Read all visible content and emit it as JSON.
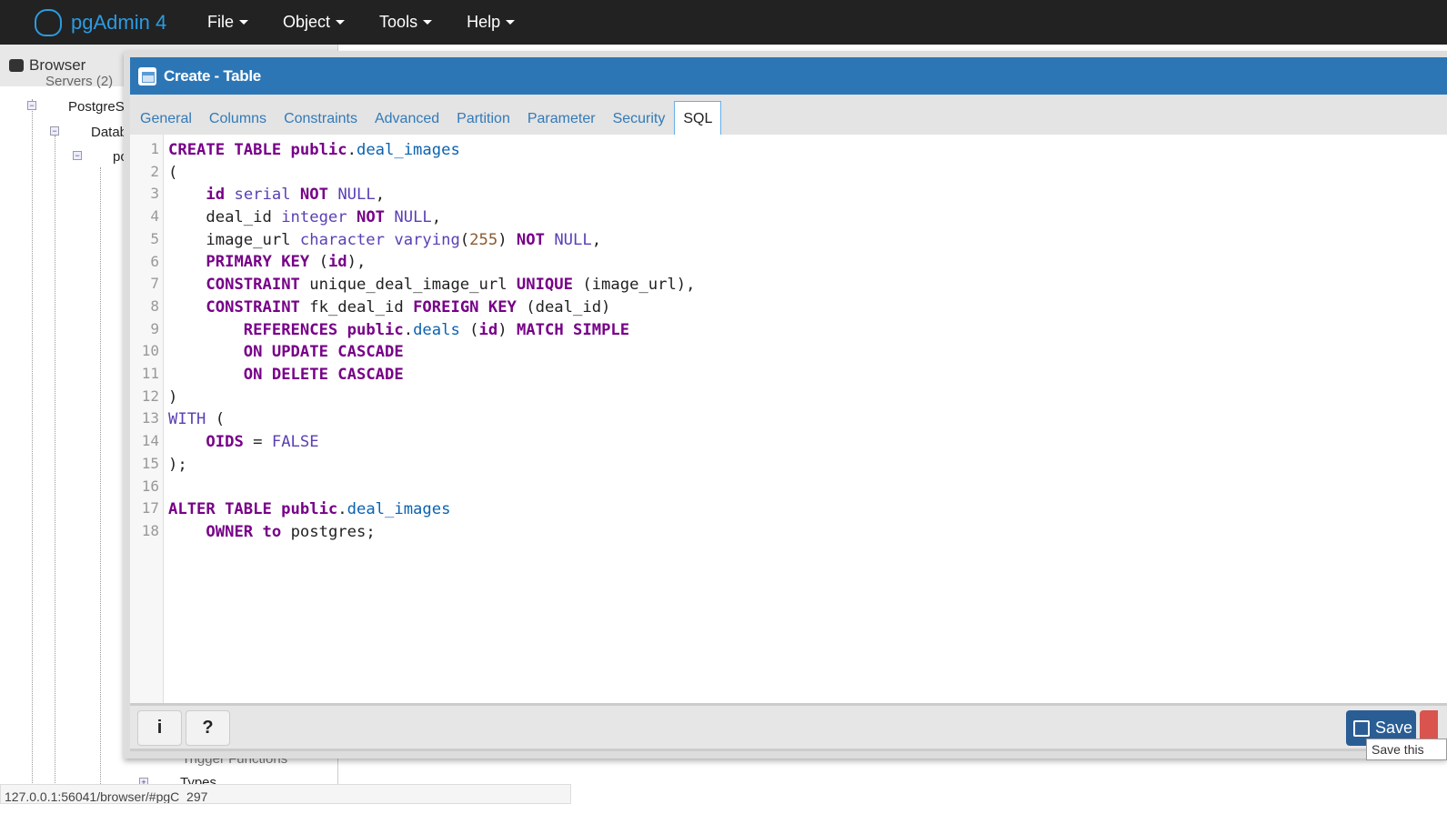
{
  "app": {
    "title": "pgAdmin 4",
    "menus": [
      "File",
      "Object",
      "Tools",
      "Help"
    ]
  },
  "browser": {
    "title": "Browser",
    "tree": [
      "Servers (2)",
      "PostgreSQL",
      "Databases",
      "postgres",
      "Trigger Functions",
      "Types"
    ]
  },
  "dialog": {
    "title": "Create - Table",
    "tabs": [
      {
        "label": "General"
      },
      {
        "label": "Columns"
      },
      {
        "label": "Constraints"
      },
      {
        "label": "Advanced"
      },
      {
        "label": "Partition"
      },
      {
        "label": "Parameter"
      },
      {
        "label": "Security"
      },
      {
        "label": "SQL",
        "active": true
      }
    ],
    "sql_lines": [
      [
        [
          "kw",
          "CREATE TABLE public"
        ],
        [
          "pl",
          "."
        ],
        [
          "tb",
          "deal_images"
        ]
      ],
      [
        [
          "pl",
          "("
        ]
      ],
      [
        [
          "pl",
          "    "
        ],
        [
          "kw",
          "id"
        ],
        [
          "pl",
          " "
        ],
        [
          "ty",
          "serial"
        ],
        [
          "pl",
          " "
        ],
        [
          "kw",
          "NOT"
        ],
        [
          "pl",
          " "
        ],
        [
          "ty",
          "NULL"
        ],
        [
          "pl",
          ","
        ]
      ],
      [
        [
          "pl",
          "    deal_id "
        ],
        [
          "ty",
          "integer"
        ],
        [
          "pl",
          " "
        ],
        [
          "kw",
          "NOT"
        ],
        [
          "pl",
          " "
        ],
        [
          "ty",
          "NULL"
        ],
        [
          "pl",
          ","
        ]
      ],
      [
        [
          "pl",
          "    image_url "
        ],
        [
          "ty",
          "character varying"
        ],
        [
          "pl",
          "("
        ],
        [
          "nm",
          "255"
        ],
        [
          "pl",
          ") "
        ],
        [
          "kw",
          "NOT"
        ],
        [
          "pl",
          " "
        ],
        [
          "ty",
          "NULL"
        ],
        [
          "pl",
          ","
        ]
      ],
      [
        [
          "pl",
          "    "
        ],
        [
          "kw",
          "PRIMARY KEY"
        ],
        [
          "pl",
          " ("
        ],
        [
          "kw",
          "id"
        ],
        [
          "pl",
          "),"
        ]
      ],
      [
        [
          "pl",
          "    "
        ],
        [
          "kw",
          "CONSTRAINT"
        ],
        [
          "pl",
          " unique_deal_image_url "
        ],
        [
          "kw",
          "UNIQUE"
        ],
        [
          "pl",
          " (image_url),"
        ]
      ],
      [
        [
          "pl",
          "    "
        ],
        [
          "kw",
          "CONSTRAINT"
        ],
        [
          "pl",
          " fk_deal_id "
        ],
        [
          "kw",
          "FOREIGN KEY"
        ],
        [
          "pl",
          " (deal_id)"
        ]
      ],
      [
        [
          "pl",
          "        "
        ],
        [
          "kw",
          "REFERENCES public"
        ],
        [
          "pl",
          "."
        ],
        [
          "tb",
          "deals"
        ],
        [
          "pl",
          " ("
        ],
        [
          "kw",
          "id"
        ],
        [
          "pl",
          ") "
        ],
        [
          "kw",
          "MATCH SIMPLE"
        ]
      ],
      [
        [
          "pl",
          "        "
        ],
        [
          "kw",
          "ON UPDATE CASCADE"
        ]
      ],
      [
        [
          "pl",
          "        "
        ],
        [
          "kw",
          "ON DELETE CASCADE"
        ]
      ],
      [
        [
          "pl",
          ")"
        ]
      ],
      [
        [
          "ty",
          "WITH"
        ],
        [
          "pl",
          " ("
        ]
      ],
      [
        [
          "pl",
          "    "
        ],
        [
          "kw",
          "OIDS"
        ],
        [
          "pl",
          " = "
        ],
        [
          "ty",
          "FALSE"
        ]
      ],
      [
        [
          "pl",
          ");"
        ]
      ],
      [],
      [
        [
          "kw",
          "ALTER TABLE public"
        ],
        [
          "pl",
          "."
        ],
        [
          "tb",
          "deal_images"
        ]
      ],
      [
        [
          "pl",
          "    "
        ],
        [
          "kw",
          "OWNER"
        ],
        [
          "pl",
          " "
        ],
        [
          "kw",
          "to"
        ],
        [
          "pl",
          " postgres;"
        ]
      ]
    ],
    "info_label": "i",
    "help_label": "?",
    "save_label": "Save",
    "save_tooltip": "Save this"
  },
  "status_url": "127.0.0.1:56041/browser/#pgC_297",
  "colors": {
    "header": "#2c76b6",
    "nav": "#222222",
    "keyword": "#770088",
    "type": "#5a3fb5",
    "table": "#0b62b0",
    "number": "#8a5a30",
    "save": "#2a5d94"
  }
}
